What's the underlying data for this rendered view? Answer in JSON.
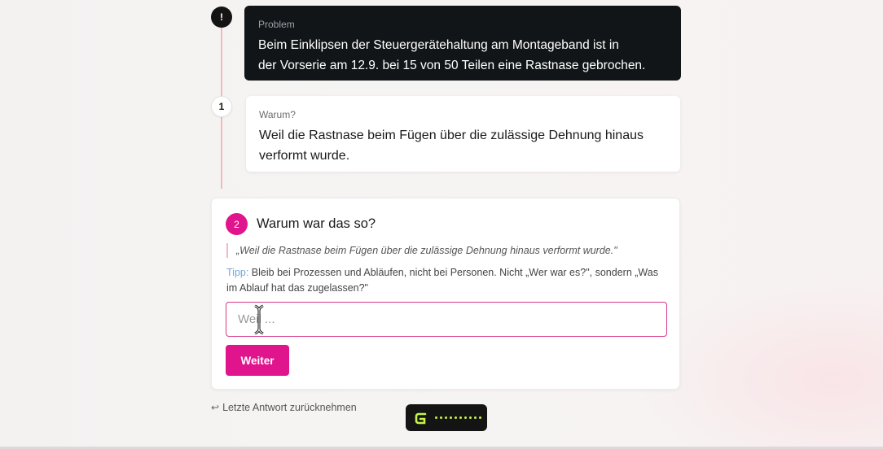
{
  "problem": {
    "marker": "!",
    "label": "Problem",
    "text_line1": "Beim Einklipsen der Steuergerätehaltung am Montageband ist in",
    "text_line2": "der Vorserie am 12.9. bei 15 von 50 Teilen eine Rastnase gebrochen."
  },
  "why1": {
    "marker": "1",
    "label": "Warum?",
    "text_line1": "Weil die Rastnase beim Fügen über die zulässige Dehnung hinaus",
    "text_line2": "verformt wurde."
  },
  "active_step": {
    "number": "2",
    "question": "Warum war das so?",
    "quote": "„Weil die Rastnase beim Fügen über die zulässige Dehnung hinaus verformt wurde.\"",
    "tip_label": "Tipp:",
    "tip_text": " Bleib bei Prozessen und Abläufen, nicht bei Personen. Nicht „Wer war es?\", sondern „Was im Ablauf hat das zugelassen?\"",
    "input_value": "",
    "input_placeholder": "Weil ...",
    "button_label": "Weiter"
  },
  "undo": {
    "icon": "↩",
    "label": "Letzte Antwort zurücknehmen"
  },
  "colors": {
    "accent": "#e0148c",
    "dark_card": "#121517",
    "loader_dots": "#c6f24a",
    "timeline": "#f0b9bf"
  },
  "icons": {
    "cursor": "text-cursor-icon",
    "loader": "loader-logo-icon",
    "undo": "undo-arrow-icon"
  }
}
